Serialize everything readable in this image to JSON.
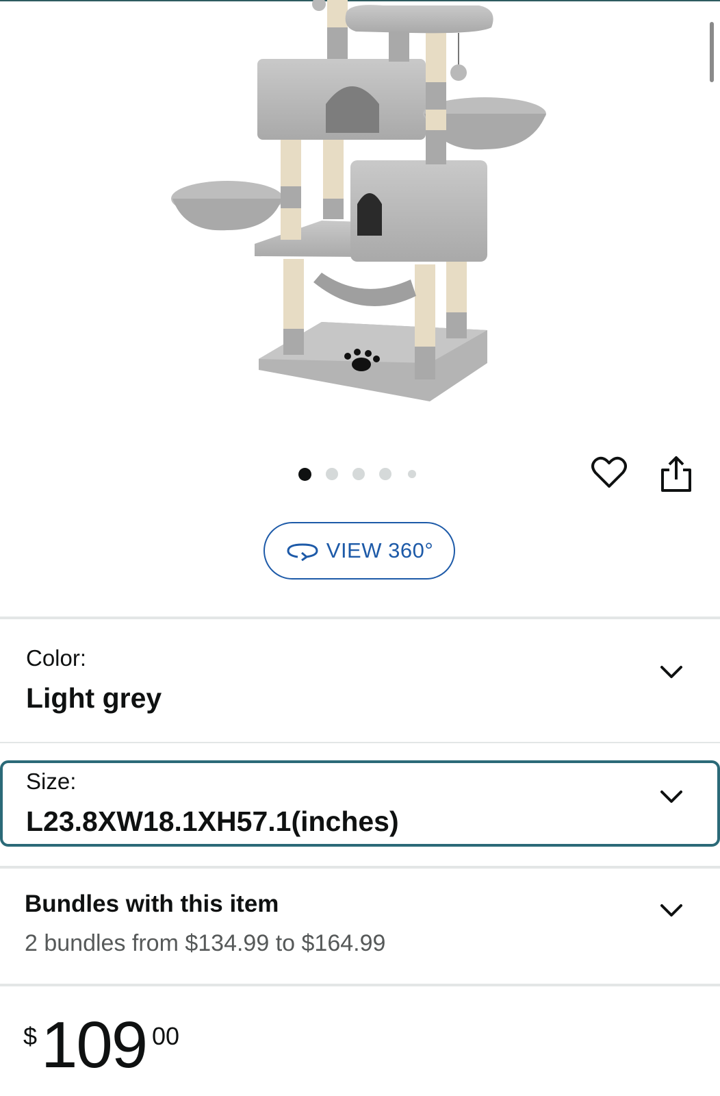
{
  "gallery": {
    "image_alt": "Light grey multi-level cat tree with condos, baskets and hammock",
    "dots_count": 5,
    "active_dot": 0
  },
  "actions": {
    "wishlist_icon": "heart-icon",
    "share_icon": "share-icon"
  },
  "view360": {
    "icon": "rotate-360-icon",
    "label": "VIEW 360°",
    "color": "#1d5aa8"
  },
  "color_selector": {
    "label": "Color:",
    "value": "Light grey"
  },
  "size_selector": {
    "label": "Size:",
    "value": "L23.8XW18.1XH57.1(inches)",
    "focus_color": "#2b6a78"
  },
  "bundles": {
    "title": "Bundles with this item",
    "subtitle": "2 bundles from $134.99 to $164.99"
  },
  "price": {
    "currency": "$",
    "whole": "109",
    "fraction": "00"
  }
}
